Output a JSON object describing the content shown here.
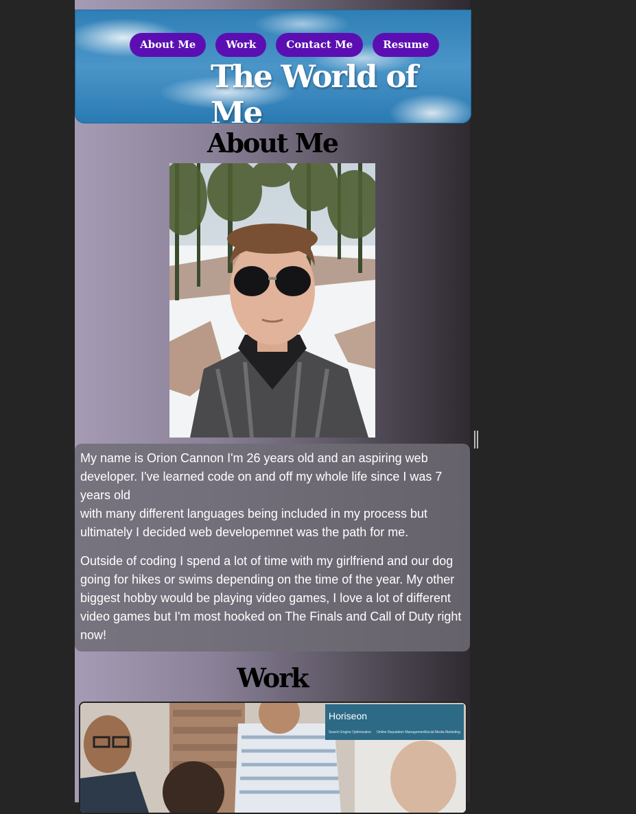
{
  "header": {
    "nav": [
      "About Me",
      "Work",
      "Contact Me",
      "Resume"
    ],
    "title": "The World of Me"
  },
  "about": {
    "heading": "About Me",
    "bio_p1_line1": "My name is Orion Cannon I'm 26 years old and an aspiring web developer. I've learned code on and off my whole life since I was 7 years old",
    "bio_p1_line2": "with many different languages being included in my process but ultimately I decided web developemnet was the path for me.",
    "bio_p2": "Outside of coding I spend a lot of time with my girlfriend and our dog going for hikes or swims depending on the time of the year. My other biggest hobby would be playing video games, I love a lot of different video games but I'm most hooked on The Finals and Call of Duty right now!"
  },
  "work": {
    "heading": "Work",
    "project_brand": "Horiseon",
    "project_nav": [
      "Search Engine Optimization",
      "Online Reputation Management",
      "Social Media Marketing"
    ]
  }
}
